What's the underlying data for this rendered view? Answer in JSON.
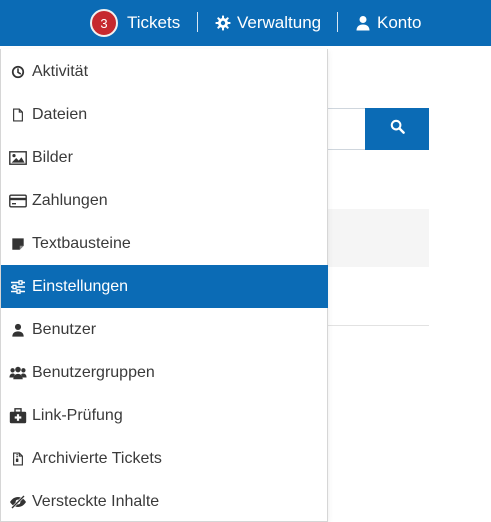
{
  "topbar": {
    "tickets_count": "3",
    "tickets_label": "Tickets",
    "separator": "|",
    "admin_label": "Verwaltung",
    "account_label": "Konto"
  },
  "menu": {
    "items": [
      {
        "label": "Aktivität",
        "icon": "clock-icon"
      },
      {
        "label": "Dateien",
        "icon": "file-icon"
      },
      {
        "label": "Bilder",
        "icon": "image-icon"
      },
      {
        "label": "Zahlungen",
        "icon": "credit-card-icon"
      },
      {
        "label": "Textbausteine",
        "icon": "sticky-note-icon"
      },
      {
        "label": "Einstellungen",
        "icon": "sliders-icon",
        "active": true
      },
      {
        "label": "Benutzer",
        "icon": "user-icon"
      },
      {
        "label": "Benutzergruppen",
        "icon": "users-icon"
      },
      {
        "label": "Link-Prüfung",
        "icon": "medkit-icon"
      },
      {
        "label": "Archivierte Tickets",
        "icon": "file-archive-icon"
      },
      {
        "label": "Versteckte Inhalte",
        "icon": "eye-slash-icon"
      }
    ]
  },
  "colors": {
    "primary": "#0b6bb5",
    "badge": "#c6292f"
  }
}
